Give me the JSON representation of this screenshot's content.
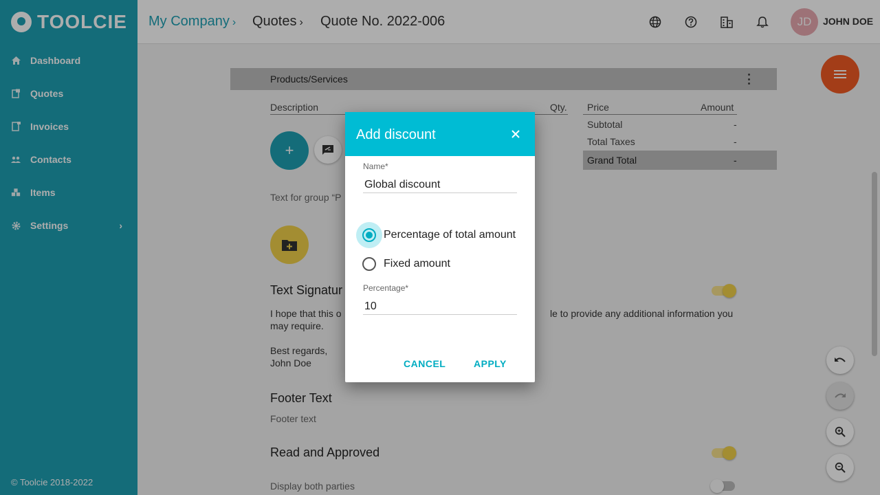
{
  "app": {
    "logo_text": "TOOLCIE"
  },
  "sidebar": {
    "items": [
      {
        "label": "Dashboard",
        "icon": "home-icon"
      },
      {
        "label": "Quotes",
        "icon": "quote-icon"
      },
      {
        "label": "Invoices",
        "icon": "invoice-icon"
      },
      {
        "label": "Contacts",
        "icon": "contacts-icon"
      },
      {
        "label": "Items",
        "icon": "items-icon"
      },
      {
        "label": "Settings",
        "icon": "gear-icon"
      }
    ],
    "copyright": "© Toolcie 2018-2022"
  },
  "header": {
    "breadcrumb": [
      "My Company",
      "Quotes",
      "Quote No. 2022-006"
    ],
    "sep": "›",
    "avatar_initials": "JD",
    "username": "JOHN DOE"
  },
  "content": {
    "section_title": "Products/Services",
    "columns": {
      "description": "Description",
      "qty": "Qty.",
      "price": "Price",
      "amount": "Amount"
    },
    "totals": {
      "subtotal_label": "Subtotal",
      "subtotal_value": "-",
      "taxes_label": "Total Taxes",
      "taxes_value": "-",
      "grand_label": "Grand Total",
      "grand_value": "-"
    },
    "add_symbol": "+",
    "text_group": "Text for group “P",
    "signature_title": "Text Signatur",
    "signature_line1": "I hope that this o",
    "signature_line1_end": "le to provide any additional information you",
    "signature_line2": "may require.",
    "regards": "Best regards,",
    "signer": "John Doe",
    "footer_title": "Footer Text",
    "footer_text": "Footer text",
    "approved_title": "Read and Approved",
    "display_both": "Display both parties"
  },
  "dialog": {
    "title": "Add discount",
    "name_label": "Name",
    "required_mark": "*",
    "name_value": "Global discount",
    "option_percentage": "Percentage of total amount",
    "option_fixed": "Fixed amount",
    "selected_option": "percentage",
    "percentage_label": "Percentage",
    "percentage_value": "10",
    "cancel_label": "CANCEL",
    "apply_label": "APPLY"
  },
  "colors": {
    "sidebar": "#1e9fb3",
    "dialog_header": "#00bcd4",
    "accent": "#00acc1",
    "fab_menu": "#f15a24",
    "toggle_on": "#f0d04a"
  }
}
